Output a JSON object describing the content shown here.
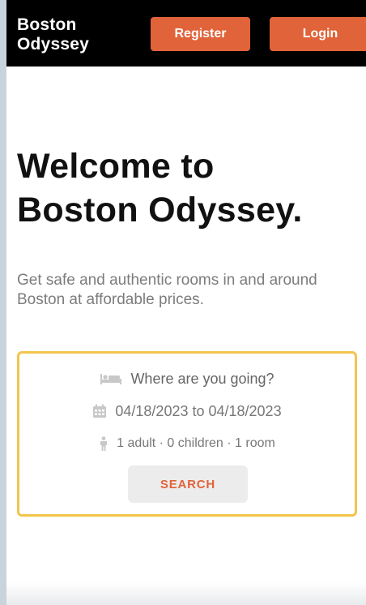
{
  "header": {
    "brand_line1": "Boston",
    "brand_line2": "Odyssey",
    "register_label": "Register",
    "login_label": "Login"
  },
  "hero": {
    "title_line1": "Welcome to",
    "title_line2": "Boston Odyssey.",
    "subtitle_line1": "Get safe and authentic rooms in and around",
    "subtitle_line2": "Boston at affordable prices."
  },
  "search": {
    "destination_placeholder": "Where are you going?",
    "dates": "04/18/2023 to 04/18/2023",
    "guests": "1 adult · 0 children · 1 room",
    "button_label": "SEARCH",
    "icons": {
      "destination": "bed-icon",
      "dates": "calendar-icon",
      "guests": "person-icon"
    }
  },
  "colors": {
    "accent": "#e0633a",
    "header_bg": "#000000",
    "card_border": "#f2c54b",
    "page_bg": "#c9d3db"
  }
}
